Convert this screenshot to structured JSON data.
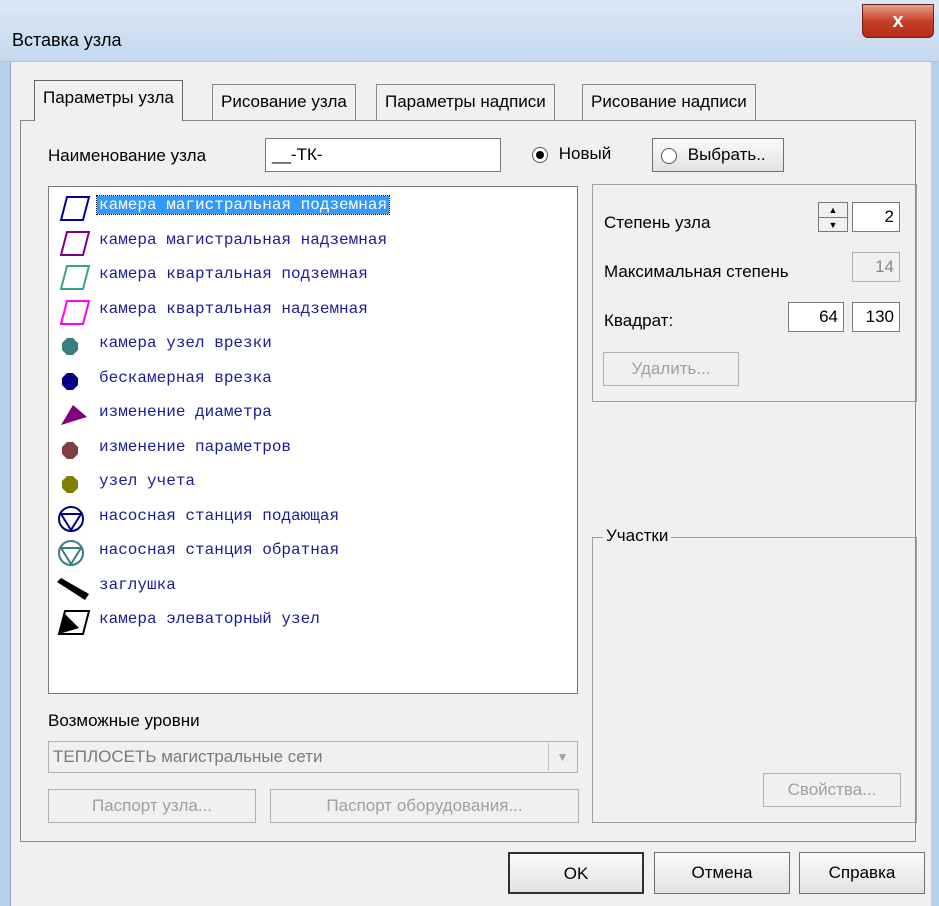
{
  "window": {
    "title": "Вставка узла",
    "close_glyph": "x"
  },
  "tabs": [
    "Параметры узла",
    "Рисование узла",
    "Параметры надписи",
    "Рисование надписи"
  ],
  "name_label": "Наименование узла",
  "name_value": "__-ТК-",
  "radio_new": "Новый",
  "radio_select": "Выбрать..",
  "node_types": [
    {
      "label": "камера магистральная подземная",
      "icon": "parallelogram-outline",
      "color": "#0000a0",
      "selected": true
    },
    {
      "label": "камера магистральная надземная",
      "icon": "parallelogram-outline",
      "color": "#800080"
    },
    {
      "label": "камера квартальная подземная",
      "icon": "parallelogram-outline",
      "color": "#40a090"
    },
    {
      "label": "камера квартальная надземная",
      "icon": "parallelogram-outline",
      "color": "#ff00ff"
    },
    {
      "label": "камера узел врезки",
      "icon": "hexagon-filled",
      "color": "#3a7f7f"
    },
    {
      "label": "бескамерная врезка",
      "icon": "hexagon-filled",
      "color": "#000080"
    },
    {
      "label": "изменение диаметра",
      "icon": "triangle-right-filled",
      "color": "#800080"
    },
    {
      "label": "изменение параметров",
      "icon": "hexagon-filled",
      "color": "#804040"
    },
    {
      "label": "узел учета",
      "icon": "hexagon-filled",
      "color": "#808000"
    },
    {
      "label": "насосная станция подающая",
      "icon": "pump-circle",
      "color": "#000080"
    },
    {
      "label": "насосная станция обратная",
      "icon": "pump-circle",
      "color": "#3a7f7f"
    },
    {
      "label": "заглушка",
      "icon": "plug-filled",
      "color": "#000000"
    },
    {
      "label": "камера элеваторный узел",
      "icon": "elevator-chamber",
      "color": "#000000"
    }
  ],
  "degree_label": "Степень узла",
  "degree_value": "2",
  "max_degree_label": "Максимальная степень",
  "max_degree_value": "14",
  "square_label": "Квадрат:",
  "square_x": "64",
  "square_y": "130",
  "delete_button": "Удалить...",
  "levels_label": "Возможные уровни",
  "levels_value": "ТЕПЛОСЕТЬ магистральные сети",
  "node_passport_button": "Паспорт узла...",
  "equipment_passport_button": "Паспорт оборудования...",
  "sections_label": "Участки",
  "properties_button": "Свойства...",
  "ok_button": "OK",
  "cancel_button": "Отмена",
  "help_button": "Справка"
}
